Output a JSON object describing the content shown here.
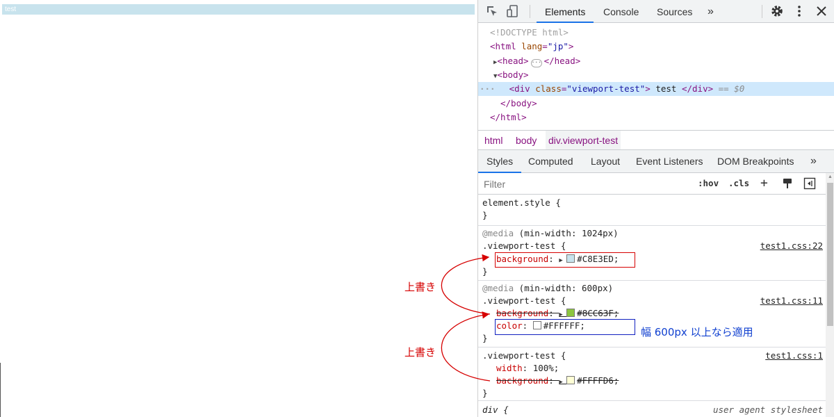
{
  "viewport": {
    "div_text": "test"
  },
  "devtools": {
    "tabs": [
      {
        "label": "Elements",
        "active": true
      },
      {
        "label": "Console"
      },
      {
        "label": "Sources"
      }
    ],
    "more_tabs": "»",
    "tree": {
      "doctype": "<!DOCTYPE html>",
      "html_open_tag": "<html",
      "lang_attr": "lang",
      "lang_val": "\"jp\"",
      "head_line": "<head>",
      "head_close": "</head>",
      "body_open": "<body>",
      "div_open": "<div",
      "class_attr": "class",
      "class_val": "\"viewport-test\"",
      "div_text": " test ",
      "div_close": "</div>",
      "eq": " == ",
      "dollar": "$0",
      "body_close": "</body>",
      "html_close": "</html>",
      "dots": "···"
    },
    "breadcrumbs": [
      "html",
      "body",
      "div.viewport-test"
    ],
    "subtabs": [
      "Styles",
      "Computed",
      "Layout",
      "Event Listeners",
      "DOM Breakpoints"
    ],
    "subtabs_more": "»",
    "filter": {
      "placeholder": "Filter"
    },
    "filter_tools": {
      "hov": ":hov",
      "cls": ".cls",
      "plus": "+"
    },
    "rules": {
      "element_style": {
        "selector": "element.style {",
        "close": "}"
      },
      "media1": {
        "at": "@media",
        "query": " (min-width: 1024px)",
        "selector": ".viewport-test {",
        "source": "test1.css:22",
        "prop": "background",
        "value": "#C8E3ED;",
        "swatch": "#C8E3ED",
        "close": "}"
      },
      "media2": {
        "at": "@media",
        "query": " (min-width: 600px)",
        "selector": ".viewport-test {",
        "source": "test1.css:11",
        "prop1": "background",
        "value1": "#8CC63F;",
        "swatch1": "#8CC63F",
        "prop2": "color",
        "value2": "#FFFFFF;",
        "swatch2": "#FFFFFF",
        "close": "}"
      },
      "base": {
        "selector": ".viewport-test {",
        "source": "test1.css:1",
        "prop1": "width",
        "value1": "100%;",
        "prop2": "background",
        "value2": "#FFFFD6;",
        "swatch2": "#FFFFD6",
        "close": "}"
      },
      "ua": {
        "selector": "div {",
        "source": "user agent stylesheet"
      }
    }
  },
  "annotations": {
    "override1": "上書き",
    "override2": "上書き",
    "note": "幅 600px 以上なら適用"
  },
  "colors": {
    "accent": "#1a73e8",
    "annotation_red": "#d60000",
    "annotation_blue": "#1040d0"
  }
}
